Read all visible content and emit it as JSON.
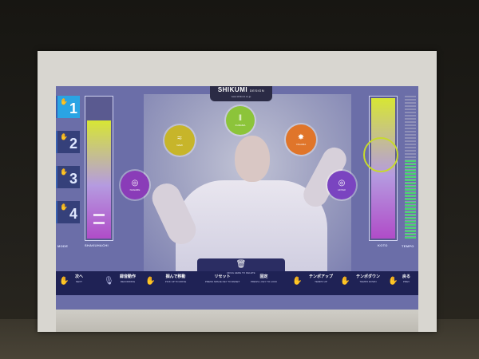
{
  "app": {
    "logo_brand": "SHIKUMI",
    "logo_suffix": "DESIGN",
    "logo_url": "www.shikumi.co.jp"
  },
  "presets": [
    {
      "num": "1",
      "active": true
    },
    {
      "num": "2",
      "active": false
    },
    {
      "num": "3",
      "active": false
    },
    {
      "num": "4",
      "active": false
    }
  ],
  "left_labels": {
    "mode": "MODE",
    "meter": "SHAKUHACHI"
  },
  "right_labels": {
    "meter": "KOTO",
    "tempo": "TEMPO"
  },
  "meters": {
    "left_level": 0.82,
    "right_level": 0.98
  },
  "tempo_level": 0.55,
  "circles": [
    {
      "name": "nami-circle",
      "glyph": "≈",
      "label": "NAMI",
      "color": "#c7b52a"
    },
    {
      "name": "kurama-circle",
      "glyph": "‖",
      "label": "KURAMA",
      "color": "#8cc43a"
    },
    {
      "name": "yagura-circle",
      "glyph": "✸",
      "label": "YAGURA",
      "color": "#e0752a"
    },
    {
      "name": "nagare-circle",
      "glyph": "◎",
      "label": "NAGARE",
      "color": "#8a3cb8"
    },
    {
      "name": "hoshi-circle",
      "glyph": "◎",
      "label": "HOSHI",
      "color": "#7a44c0"
    }
  ],
  "bottom_bar": {
    "next_ja": "次へ",
    "next_en": "NEXT",
    "recording_ja": "録音動作",
    "recording_en": "RECORDING",
    "pickup_ja": "掴んで移動",
    "pickup_en": "PICK UP TO MOVE",
    "drag_en": "DRAG HERE TO DELETE",
    "reset_ja": "リセット",
    "reset_en": "PRESS SPACE KEY TO RESET",
    "lock_ja": "固定",
    "lock_en": "PRESS L KEY TO LOCK",
    "tempo_up_ja": "テンポアップ",
    "tempo_up_en": "TEMPO UP",
    "tempo_down_ja": "テンポダウン",
    "tempo_down_en": "TEMPO DOWN",
    "prev_ja": "戻る",
    "prev_en": "PREV"
  }
}
